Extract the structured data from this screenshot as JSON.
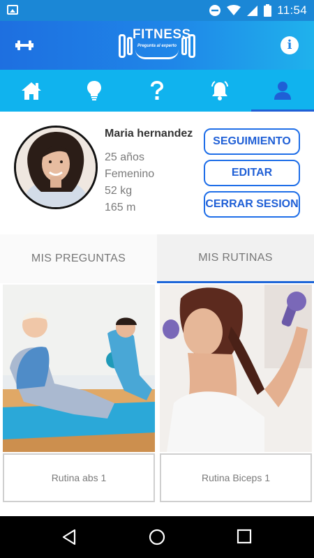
{
  "status_bar": {
    "time": "11:54",
    "icons": [
      "image-icon",
      "do-not-disturb-icon",
      "wifi-icon",
      "signal-icon",
      "battery-icon"
    ]
  },
  "app_bar": {
    "logo_text": "FITNESS",
    "logo_tagline": "Pregunta al experto",
    "left_icon": "dumbbell-icon",
    "right_icon": "info-icon",
    "info_glyph": "i"
  },
  "tabs": [
    {
      "icon": "home-icon",
      "active": false
    },
    {
      "icon": "lightbulb-icon",
      "active": false
    },
    {
      "icon": "question-icon",
      "active": false
    },
    {
      "icon": "bell-icon",
      "active": false
    },
    {
      "icon": "person-icon",
      "active": true
    }
  ],
  "profile": {
    "name": "Maria hernandez",
    "age": "25 años",
    "gender": "Femenino",
    "weight": "52 kg",
    "height": "165 m"
  },
  "actions": {
    "seguimiento": "SEGUIMIENTO",
    "editar": "EDITAR",
    "cerrar_sesion": "CERRAR SESION"
  },
  "segments": {
    "preguntas": "MIS PREGUNTAS",
    "rutinas": "MIS RUTINAS",
    "selected": "MIS RUTINAS"
  },
  "routines": [
    {
      "title": "Rutina abs 1"
    },
    {
      "title": "Rutina Biceps 1"
    }
  ],
  "colors": {
    "status_bar": "#1b87d6",
    "app_bar_start": "#1e6fe0",
    "app_bar_end": "#1fb2ec",
    "tab_bar": "#10b3ee",
    "accent": "#1f5fd6",
    "nav_bar": "#000000"
  }
}
